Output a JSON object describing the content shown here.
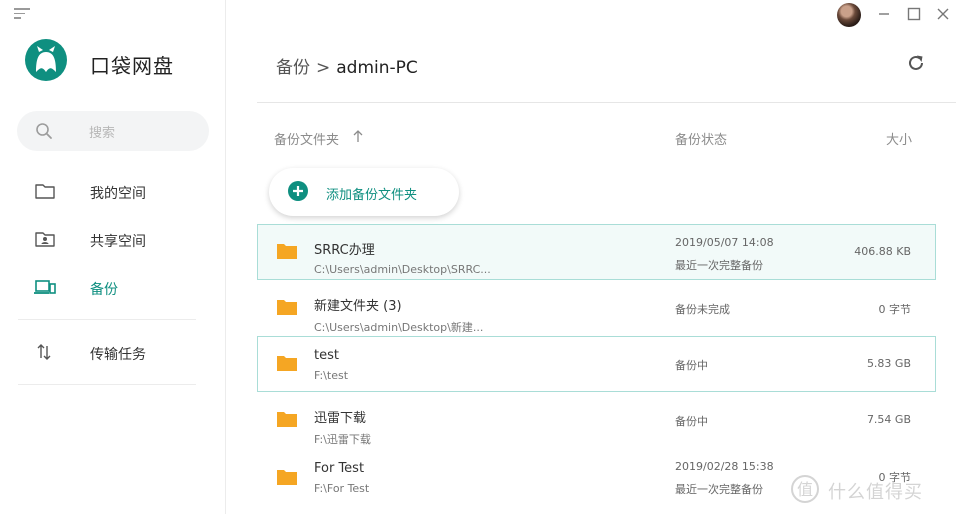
{
  "app": {
    "name": "口袋网盘"
  },
  "search": {
    "placeholder": "搜索"
  },
  "sidebar": {
    "items": [
      {
        "label": "我的空间",
        "icon": "folder-icon"
      },
      {
        "label": "共享空间",
        "icon": "shared-folder-icon"
      },
      {
        "label": "备份",
        "icon": "backup-devices-icon",
        "active": true
      },
      {
        "label": "传输任务",
        "icon": "transfer-icon"
      }
    ]
  },
  "breadcrumb": {
    "parent": "备份",
    "separator": ">",
    "current": "admin-PC"
  },
  "columns": {
    "folder": "备份文件夹",
    "status": "备份状态",
    "size": "大小"
  },
  "add_button": {
    "label": "添加备份文件夹"
  },
  "rows": [
    {
      "name": "SRRC办理",
      "path": "C:\\Users\\admin\\Desktop\\SRRC...",
      "time": "2019/05/07 14:08",
      "status": "最近一次完整备份",
      "size": "406.88 KB"
    },
    {
      "name": "新建文件夹 (3)",
      "path": "C:\\Users\\admin\\Desktop\\新建...",
      "time": "",
      "status": "备份未完成",
      "size": "0 字节"
    },
    {
      "name": "test",
      "path": "F:\\test",
      "time": "",
      "status": "备份中",
      "size": "5.83 GB"
    },
    {
      "name": "迅雷下载",
      "path": "F:\\迅雷下载",
      "time": "",
      "status": "备份中",
      "size": "7.54 GB"
    },
    {
      "name": "For Test",
      "path": "F:\\For Test",
      "time": "2019/02/28 15:38",
      "status": "最近一次完整备份",
      "size": "0 字节"
    }
  ],
  "watermark": {
    "text": "什么值得买"
  },
  "colors": {
    "accent": "#0f8f80",
    "folder": "#f5a623",
    "selected_bg": "#f2faf9",
    "selected_border": "#a9ddd7"
  }
}
